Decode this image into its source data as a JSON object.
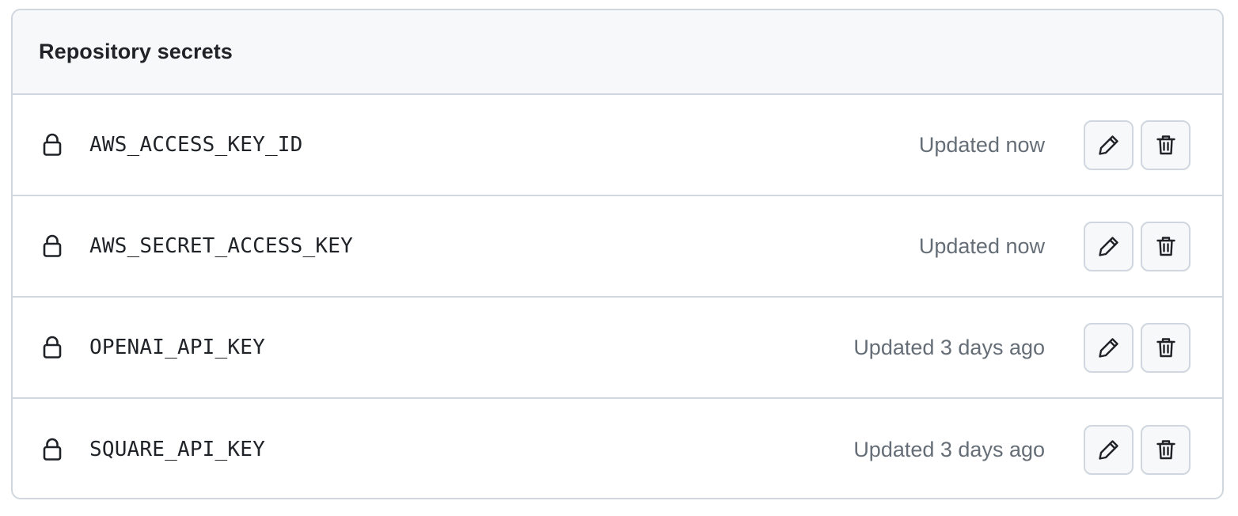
{
  "panel": {
    "title": "Repository secrets"
  },
  "secrets": [
    {
      "name": "AWS_ACCESS_KEY_ID",
      "updated": "Updated now"
    },
    {
      "name": "AWS_SECRET_ACCESS_KEY",
      "updated": "Updated now"
    },
    {
      "name": "OPENAI_API_KEY",
      "updated": "Updated 3 days ago"
    },
    {
      "name": "SQUARE_API_KEY",
      "updated": "Updated 3 days ago"
    }
  ],
  "icons": {
    "row_icon": "lock-icon",
    "edit_icon": "pencil-icon",
    "delete_icon": "trash-icon"
  },
  "colors": {
    "border": "#d0d7de",
    "header_bg": "#f6f8fa",
    "text": "#1f2328",
    "muted_text": "#656d76"
  }
}
